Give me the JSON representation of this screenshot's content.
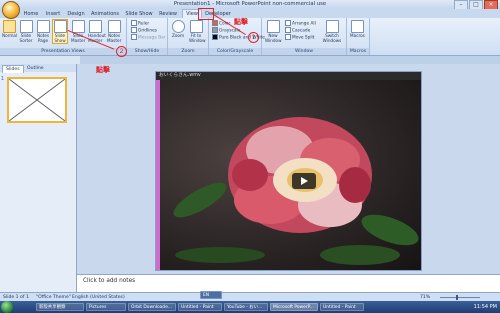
{
  "window": {
    "title": "Presentation1 - Microsoft PowerPoint non-commercial use"
  },
  "tabs": [
    "Home",
    "Insert",
    "Design",
    "Animations",
    "Slide Show",
    "Review",
    "View",
    "Developer"
  ],
  "active_tab": "View",
  "ribbon": {
    "presentation_views": {
      "buttons": [
        "Normal",
        "Slide Sorter",
        "Notes Page",
        "Slide Show",
        "Slide Master",
        "Handout Master",
        "Notes Master"
      ],
      "label": "Presentation Views"
    },
    "show_hide": {
      "items": [
        "Ruler",
        "Gridlines",
        "Message Bar"
      ],
      "label": "Show/Hide"
    },
    "zoom": {
      "buttons": [
        "Zoom",
        "Fit to Window"
      ],
      "label": "Zoom"
    },
    "color_grayscale": {
      "items": [
        "Color",
        "Grayscale",
        "Pure Black and White"
      ],
      "label": "Color/Grayscale"
    },
    "window": {
      "new_window": "New Window",
      "items": [
        "Arrange All",
        "Cascade",
        "Move Split"
      ],
      "switch": "Switch Windows",
      "label": "Window"
    },
    "macros": {
      "button": "Macros",
      "label": "Macros"
    }
  },
  "left_pane": {
    "tabs": [
      "Slides",
      "Outline"
    ],
    "slide_number": "1"
  },
  "video": {
    "filename": "おいくらさん.wmv"
  },
  "notes": {
    "placeholder": "Click to add notes"
  },
  "status": {
    "slide": "Slide 1 of 1",
    "theme": "\"Office Theme\"",
    "language": "English (United States)",
    "zoom": "71%"
  },
  "taskbar": {
    "items": [
      "新版共享觀察",
      "Pictures",
      "Orbit Downloade...",
      "Untitled - Paint",
      "YouTube - おい...",
      "Microsoft PowerP...",
      "Untitled - Paint"
    ],
    "language": "EN",
    "clock": "11:54 PM"
  },
  "annotations": {
    "click": "點擊",
    "one": "1",
    "two": "2"
  }
}
